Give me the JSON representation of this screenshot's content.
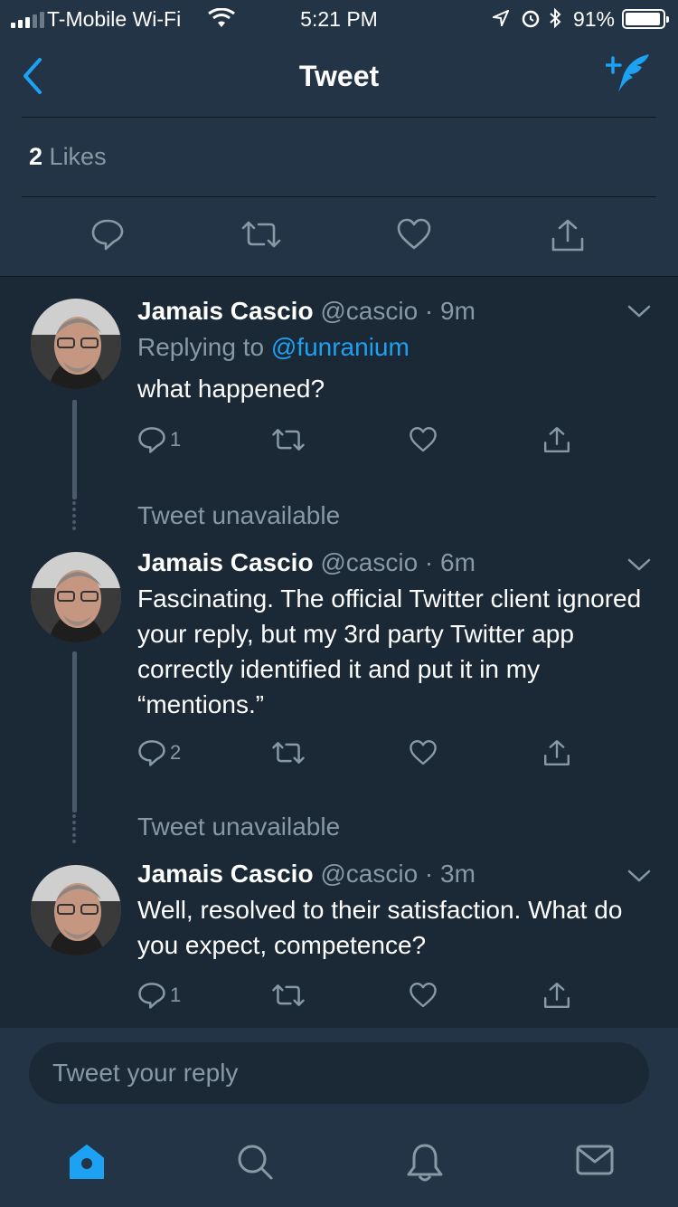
{
  "status_bar": {
    "carrier": "T-Mobile Wi-Fi",
    "time": "5:21 PM",
    "battery": "91%"
  },
  "nav": {
    "title": "Tweet",
    "back_icon": "chevron-left-icon",
    "compose_icon": "compose-tweet-icon"
  },
  "likes": {
    "count": "2",
    "label": "Likes"
  },
  "main_actions": [
    "reply-icon",
    "retweet-icon",
    "like-icon",
    "share-icon"
  ],
  "replies": [
    {
      "name": "Jamais Cascio",
      "handle": "@cascio",
      "time": "9m",
      "replying_prefix": "Replying to",
      "replying_to": "@funranium",
      "text": "what happened?",
      "reply_count": "1"
    },
    {
      "unavailable": "Tweet unavailable"
    },
    {
      "name": "Jamais Cascio",
      "handle": "@cascio",
      "time": "6m",
      "text": "Fascinating. The official Twitter client ignored your reply, but my 3rd party Twitter app correctly identified it and put it in my “mentions.”",
      "reply_count": "2"
    },
    {
      "unavailable": "Tweet unavailable"
    },
    {
      "name": "Jamais Cascio",
      "handle": "@cascio",
      "time": "3m",
      "text": "Well, resolved to their satisfaction. What do you expect, competence?",
      "reply_count": "1"
    }
  ],
  "reply_box": {
    "placeholder": "Tweet your reply"
  },
  "tabbar": [
    "home-icon",
    "search-icon",
    "notifications-icon",
    "messages-icon"
  ],
  "colors": {
    "accent": "#1da1f2",
    "background": "#1b2836",
    "surface": "#243447",
    "muted_text": "#8899a6"
  }
}
